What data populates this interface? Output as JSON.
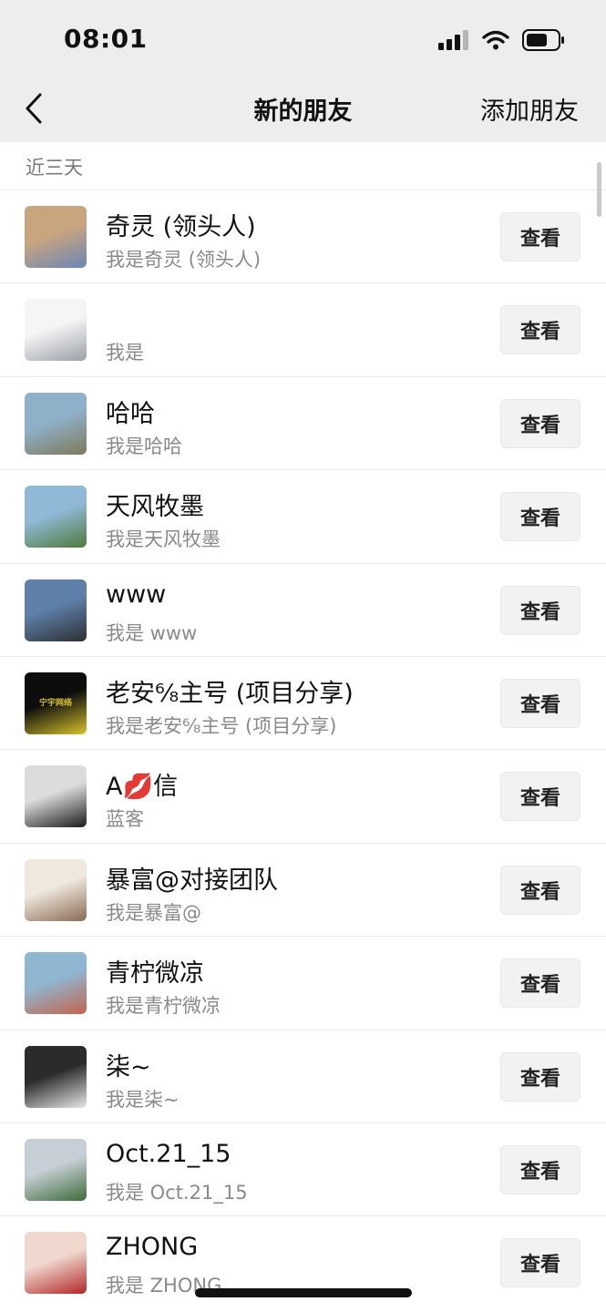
{
  "status_bar": {
    "time": "08:01"
  },
  "nav": {
    "title": "新的朋友",
    "add_friend_label": "添加朋友"
  },
  "section": {
    "label": "近三天"
  },
  "colors": {
    "background": "#ffffff",
    "header_bg": "#ededed",
    "button_bg": "#f2f2f2",
    "secondary_text": "#8a8a8a"
  },
  "requests": [
    {
      "name": "奇灵 (领头人)",
      "message": "我是奇灵 (领头人)",
      "action": "查看",
      "avatar_colors": [
        "#c9a57e",
        "#6b86b5"
      ]
    },
    {
      "name": "",
      "message": "我是",
      "action": "查看",
      "avatar_colors": [
        "#f5f5f5",
        "#9aa0a8"
      ]
    },
    {
      "name": "哈哈",
      "message": "我是哈哈",
      "action": "查看",
      "avatar_colors": [
        "#8fb0c9",
        "#7e7a5a"
      ]
    },
    {
      "name": "天风牧墨",
      "message": "我是天风牧墨",
      "action": "查看",
      "avatar_colors": [
        "#8fb9d6",
        "#4f7a3c"
      ]
    },
    {
      "name": "www",
      "message": "我是 www",
      "action": "查看",
      "avatar_colors": [
        "#5d7fa8",
        "#2d2f33"
      ]
    },
    {
      "name": "老安⁶⁄₈主号 (项目分享)",
      "message": "我是老安⁶⁄₈主号 (项目分享)",
      "action": "查看",
      "avatar_colors": [
        "#0d0d0d",
        "#d7c32a"
      ],
      "avatar_text": "宁宇网络"
    },
    {
      "name": "A💋信",
      "message": "蓝客",
      "action": "查看",
      "avatar_colors": [
        "#dcdcdc",
        "#1a1a1a"
      ]
    },
    {
      "name": "暴富@对接团队",
      "message": "我是暴富@",
      "action": "查看",
      "avatar_colors": [
        "#efe8df",
        "#8a6a52"
      ]
    },
    {
      "name": "青柠微凉",
      "message": "我是青柠微凉",
      "action": "查看",
      "avatar_colors": [
        "#8fb7d2",
        "#c4634a"
      ]
    },
    {
      "name": "柒~",
      "message": "我是柒~",
      "action": "查看",
      "avatar_colors": [
        "#2b2b2b",
        "#e8e8e8"
      ]
    },
    {
      "name": "Oct.21_15",
      "message": "我是 Oct.21_15",
      "action": "查看",
      "avatar_colors": [
        "#c7cfd6",
        "#3e6b3a"
      ]
    },
    {
      "name": "ZHONG",
      "message": "我是 ZHONG",
      "action": "查看",
      "avatar_colors": [
        "#f0d8cf",
        "#b02626"
      ]
    }
  ]
}
